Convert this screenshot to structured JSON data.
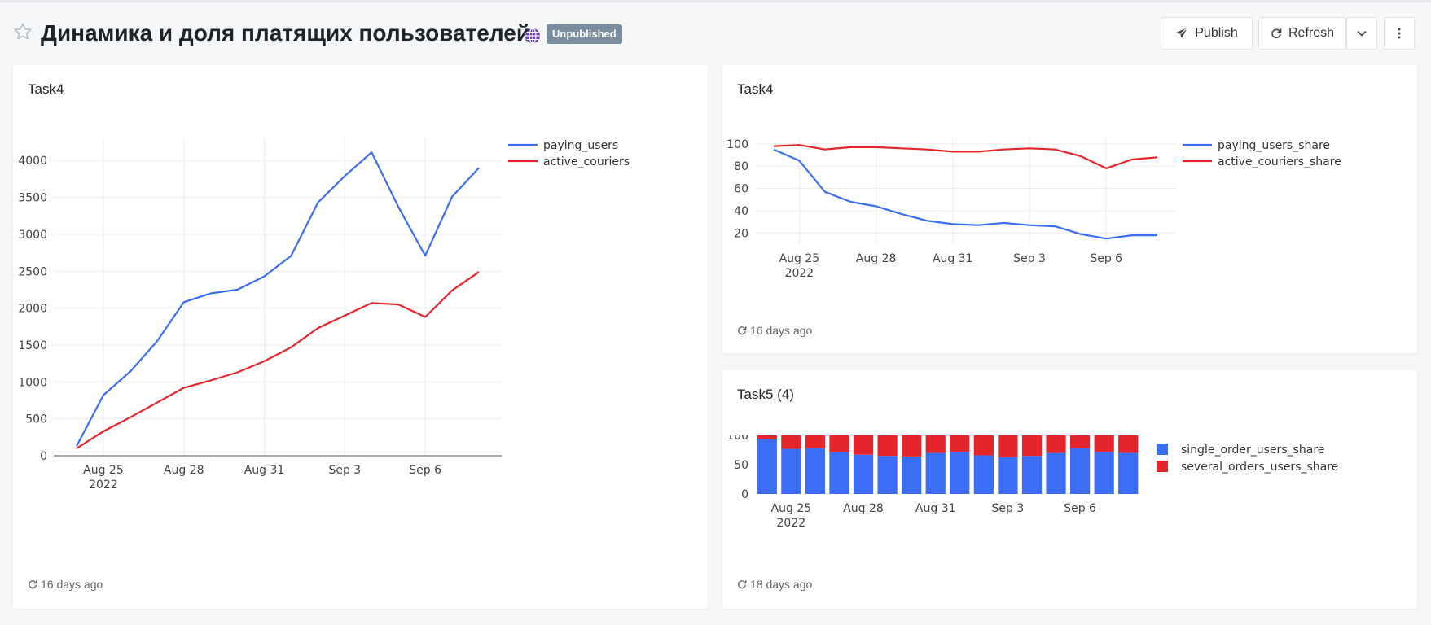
{
  "header": {
    "title": "Динамика и доля платящих пользователей",
    "status_badge": "Unpublished",
    "publish_label": "Publish",
    "refresh_label": "Refresh",
    "star_icon": "star-outline-icon",
    "globe_icon": "globe-icon"
  },
  "colors": {
    "blue": "#3b6ef5",
    "red": "#e4262c",
    "badge": "#7b8da0"
  },
  "cards": [
    {
      "title": "Task4",
      "footer": "16 days ago"
    },
    {
      "title": "Task4",
      "footer": "16 days ago"
    },
    {
      "title": "Task5 (4)",
      "footer": "18 days ago"
    }
  ],
  "chart_data": [
    {
      "type": "line",
      "x": [
        "2022-08-24",
        "2022-08-25",
        "2022-08-26",
        "2022-08-27",
        "2022-08-28",
        "2022-08-29",
        "2022-08-30",
        "2022-08-31",
        "2022-09-01",
        "2022-09-02",
        "2022-09-03",
        "2022-09-04",
        "2022-09-05",
        "2022-09-06",
        "2022-09-07",
        "2022-09-08"
      ],
      "x_ticks": [
        {
          "date": "2022-08-25",
          "label": "Aug 25",
          "sublabel": "2022"
        },
        {
          "date": "2022-08-28",
          "label": "Aug 28",
          "sublabel": ""
        },
        {
          "date": "2022-08-31",
          "label": "Aug 31",
          "sublabel": ""
        },
        {
          "date": "2022-09-03",
          "label": "Sep 3",
          "sublabel": ""
        },
        {
          "date": "2022-09-06",
          "label": "Sep 6",
          "sublabel": ""
        }
      ],
      "series": [
        {
          "name": "paying_users",
          "color": "#3b6ef5",
          "values": [
            130,
            820,
            1140,
            1550,
            2080,
            2200,
            2250,
            2430,
            2710,
            3430,
            3790,
            4110,
            3370,
            2710,
            3510,
            3900
          ]
        },
        {
          "name": "active_couriers",
          "color": "#e4262c",
          "values": [
            100,
            330,
            520,
            720,
            920,
            1020,
            1130,
            1280,
            1470,
            1730,
            1900,
            2070,
            2050,
            1880,
            2240,
            2490
          ]
        }
      ],
      "yticks": [
        0,
        500,
        1000,
        1500,
        2000,
        2500,
        3000,
        3500,
        4000
      ],
      "ylim": [
        0,
        4300
      ],
      "grid": true,
      "legend": "right"
    },
    {
      "type": "line",
      "x": [
        "2022-08-24",
        "2022-08-25",
        "2022-08-26",
        "2022-08-27",
        "2022-08-28",
        "2022-08-29",
        "2022-08-30",
        "2022-08-31",
        "2022-09-01",
        "2022-09-02",
        "2022-09-03",
        "2022-09-04",
        "2022-09-05",
        "2022-09-06",
        "2022-09-07",
        "2022-09-08"
      ],
      "x_ticks": [
        {
          "date": "2022-08-25",
          "label": "Aug 25",
          "sublabel": "2022"
        },
        {
          "date": "2022-08-28",
          "label": "Aug 28",
          "sublabel": ""
        },
        {
          "date": "2022-08-31",
          "label": "Aug 31",
          "sublabel": ""
        },
        {
          "date": "2022-09-03",
          "label": "Sep 3",
          "sublabel": ""
        },
        {
          "date": "2022-09-06",
          "label": "Sep 6",
          "sublabel": ""
        }
      ],
      "series": [
        {
          "name": "paying_users_share",
          "color": "#3b6ef5",
          "values": [
            95,
            85,
            57,
            48,
            44,
            37,
            31,
            28,
            27,
            29,
            27,
            26,
            19,
            15,
            18,
            18
          ]
        },
        {
          "name": "active_couriers_share",
          "color": "#e4262c",
          "values": [
            98,
            99,
            95,
            97,
            97,
            96,
            95,
            93,
            93,
            95,
            96,
            95,
            89,
            78,
            86,
            88
          ]
        }
      ],
      "yticks": [
        20,
        40,
        60,
        80,
        100
      ],
      "ylim": [
        10,
        105
      ],
      "grid": true,
      "legend": "right"
    },
    {
      "type": "bar",
      "stacked": true,
      "x": [
        "2022-08-24",
        "2022-08-25",
        "2022-08-26",
        "2022-08-27",
        "2022-08-28",
        "2022-08-29",
        "2022-08-30",
        "2022-08-31",
        "2022-09-01",
        "2022-09-02",
        "2022-09-03",
        "2022-09-04",
        "2022-09-05",
        "2022-09-06",
        "2022-09-07",
        "2022-09-08"
      ],
      "x_ticks": [
        {
          "date": "2022-08-25",
          "label": "Aug 25",
          "sublabel": "2022"
        },
        {
          "date": "2022-08-28",
          "label": "Aug 28",
          "sublabel": ""
        },
        {
          "date": "2022-08-31",
          "label": "Aug 31",
          "sublabel": ""
        },
        {
          "date": "2022-09-03",
          "label": "Sep 3",
          "sublabel": ""
        },
        {
          "date": "2022-09-06",
          "label": "Sep 6",
          "sublabel": ""
        }
      ],
      "series": [
        {
          "name": "single_order_users_share",
          "color": "#3b6ef5",
          "values": [
            93,
            77,
            78,
            71,
            67,
            65,
            64,
            70,
            72,
            66,
            63,
            65,
            70,
            78,
            72,
            70
          ]
        },
        {
          "name": "several_orders_users_share",
          "color": "#e4262c",
          "values": [
            7,
            23,
            22,
            29,
            33,
            35,
            36,
            30,
            28,
            34,
            37,
            35,
            30,
            22,
            28,
            30
          ]
        }
      ],
      "yticks": [
        0,
        50,
        100
      ],
      "ylim": [
        0,
        100
      ],
      "grid": false,
      "legend": "right"
    }
  ]
}
